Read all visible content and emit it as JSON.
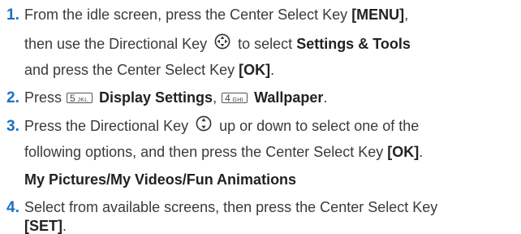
{
  "steps": [
    {
      "number": "1.",
      "t1": "From the idle screen, press the Center Select Key ",
      "b1": "[MENU]",
      "t2": ",",
      "t3": "then use the Directional Key ",
      "t4": " to select ",
      "b2": "Settings & Tools",
      "t5": "and press the Center Select Key ",
      "b3": "[OK]",
      "t6": "."
    },
    {
      "number": "2.",
      "t1": "Press ",
      "key1_digit": "5",
      "key1_letters": "JKL",
      "b1": " Display Settings",
      "t2": ", ",
      "key2_digit": "4",
      "key2_letters": "GHI",
      "b2": " Wallpaper",
      "t3": "."
    },
    {
      "number": "3.",
      "t1": "Press the Directional Key ",
      "t2": " up or down to select one of the",
      "t3": "following options, and then press the Center Select Key ",
      "b1": "[OK]",
      "t4": ".",
      "b2": "My Pictures/My Videos/Fun Animations"
    },
    {
      "number": "4.",
      "t1": "Select from available screens, then press the Center Select Key",
      "b1": "[SET]",
      "t2": "."
    }
  ],
  "icons": {
    "nav4": "four-way-directional-key-icon",
    "nav2": "up-down-directional-key-icon"
  }
}
